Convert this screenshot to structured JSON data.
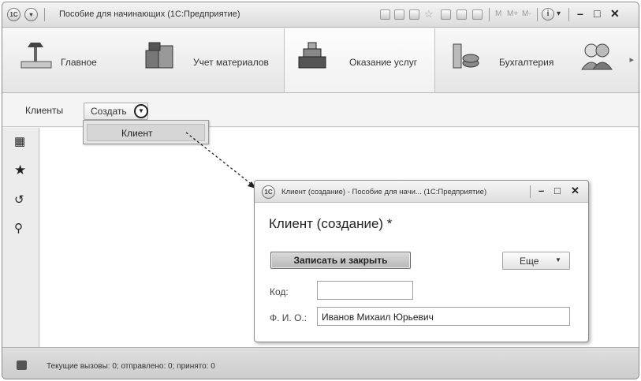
{
  "window": {
    "logo_text": "1С",
    "title": "Пособие для начинающих  (1С:Предприятие)",
    "memory_buttons": [
      "M",
      "M+",
      "M-"
    ]
  },
  "sections": [
    {
      "label": "Главное",
      "icon": "desk-lamp-icon",
      "active": false
    },
    {
      "label": "Учет материалов",
      "icon": "boxes-icon",
      "active": false
    },
    {
      "label": "Оказание услуг",
      "icon": "cash-register-icon",
      "active": true
    },
    {
      "label": "Бухгалтерия",
      "icon": "coins-icon",
      "active": false
    },
    {
      "label": "",
      "icon": "users-icon",
      "active": false
    }
  ],
  "command_bar": {
    "breadcrumb": "Клиенты",
    "create_label": "Создать"
  },
  "dropdown": {
    "items": [
      "Клиент"
    ]
  },
  "status_bar": {
    "text": "Текущие вызовы: 0; отправлено: 0; принято: 0"
  },
  "dialog": {
    "title": "Клиент (создание) - Пособие для начи...  (1С:Предприятие)",
    "heading": "Клиент (создание) *",
    "save_close_label": "Записать и закрыть",
    "more_label": "Еще",
    "fields": {
      "code_label": "Код:",
      "code_value": "",
      "name_label": "Ф. И. О.:",
      "name_value": "Иванов Михаил Юрьевич"
    }
  },
  "colors": {
    "accent_text": "#222222",
    "panel_bg": "#f2f2f2",
    "border": "#8a8a8a"
  }
}
